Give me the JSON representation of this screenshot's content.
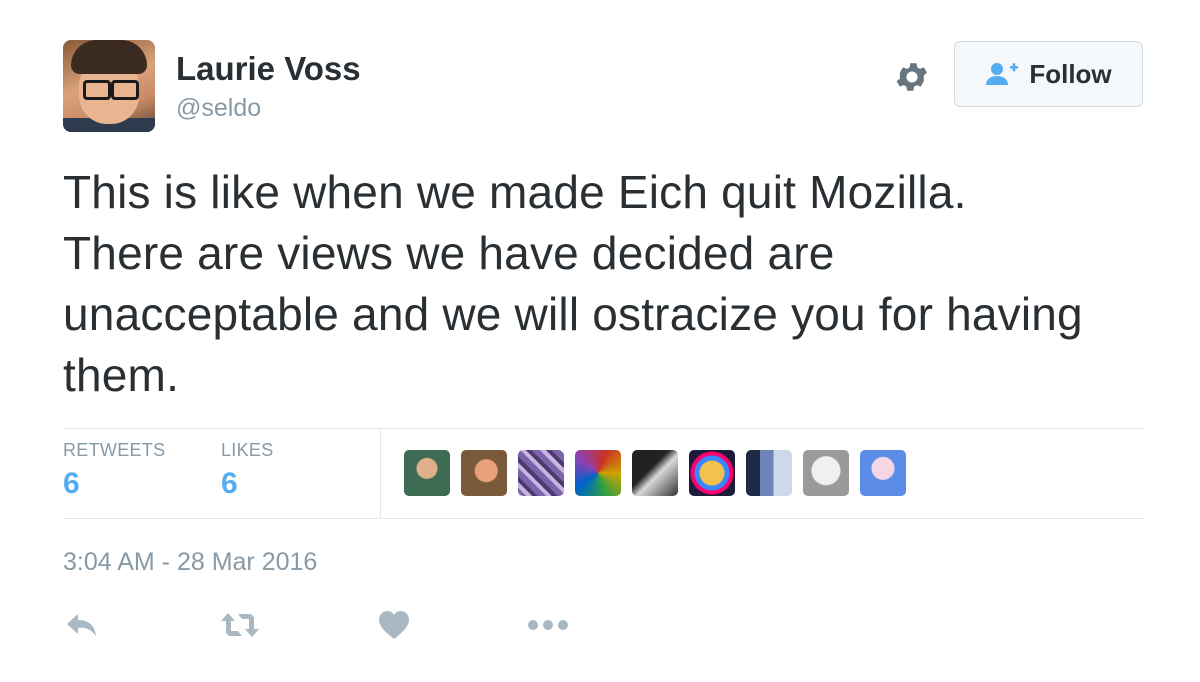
{
  "user": {
    "name": "Laurie Voss",
    "handle": "@seldo"
  },
  "header": {
    "follow_label": "Follow",
    "follow_icon": "add-user-icon",
    "settings_icon": "gear-icon"
  },
  "tweet": {
    "text": "This is like when we made Eich quit Mozilla. There are views we have decided are unacceptable and we will ostracize you for having them."
  },
  "stats": {
    "retweets_label": "RETWEETS",
    "retweets_count": "6",
    "likes_label": "LIKES",
    "likes_count": "6"
  },
  "likers": [
    {
      "icon": "avatar-1"
    },
    {
      "icon": "avatar-2"
    },
    {
      "icon": "avatar-3"
    },
    {
      "icon": "avatar-4"
    },
    {
      "icon": "avatar-5"
    },
    {
      "icon": "avatar-6"
    },
    {
      "icon": "avatar-7"
    },
    {
      "icon": "avatar-8"
    },
    {
      "icon": "avatar-9"
    }
  ],
  "timestamp": "3:04 AM - 28 Mar 2016",
  "actions": {
    "reply_icon": "reply-icon",
    "retweet_icon": "retweet-icon",
    "like_icon": "heart-icon",
    "more_icon": "more-icon"
  },
  "colors": {
    "accent": "#55acee",
    "muted": "#8899a6",
    "text": "#292f33",
    "action_icon": "#aab8c2"
  }
}
